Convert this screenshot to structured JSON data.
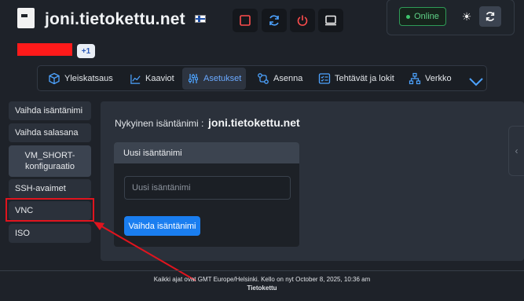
{
  "header": {
    "title": "joni.tietokettu.net",
    "flag_icon": "finland-flag-icon",
    "buttons": [
      "stop-icon",
      "refresh-icon",
      "power-icon",
      "console-icon"
    ],
    "status": "Online",
    "colors": {
      "danger": "#e0141e",
      "online": "#3ec46d",
      "accent": "#1a7ef0"
    }
  },
  "badge": {
    "count": "+1"
  },
  "tabs": [
    {
      "label": "Yleiskatsaus",
      "icon": "cube-icon"
    },
    {
      "label": "Kaaviot",
      "icon": "chart-line-icon"
    },
    {
      "label": "Asetukset",
      "icon": "sliders-icon",
      "active": true
    },
    {
      "label": "Asenna",
      "icon": "install-icon"
    },
    {
      "label": "Tehtävät ja lokit",
      "icon": "tasks-icon"
    },
    {
      "label": "Verkko",
      "icon": "network-icon"
    }
  ],
  "sidebar": {
    "items": [
      {
        "label": "Vaihda isäntänimi"
      },
      {
        "label": "Vaihda salasana"
      },
      {
        "label": "VM_SHORT-konfiguraatio"
      },
      {
        "label": "SSH-avaimet"
      },
      {
        "label": "VNC"
      },
      {
        "label": "ISO"
      }
    ]
  },
  "main": {
    "current_label": "Nykyinen isäntänimi :",
    "current_value": "joni.tietokettu.net",
    "card_title": "Uusi isäntänimi",
    "input_placeholder": "Uusi isäntänimi",
    "submit_label": "Vaihda isäntänimi"
  },
  "footer": {
    "text": "Kaikki ajat ovat GMT Europe/Helsinki. Kello on nyt October 8, 2025, 10:36 am",
    "brand": "Tietokettu"
  }
}
